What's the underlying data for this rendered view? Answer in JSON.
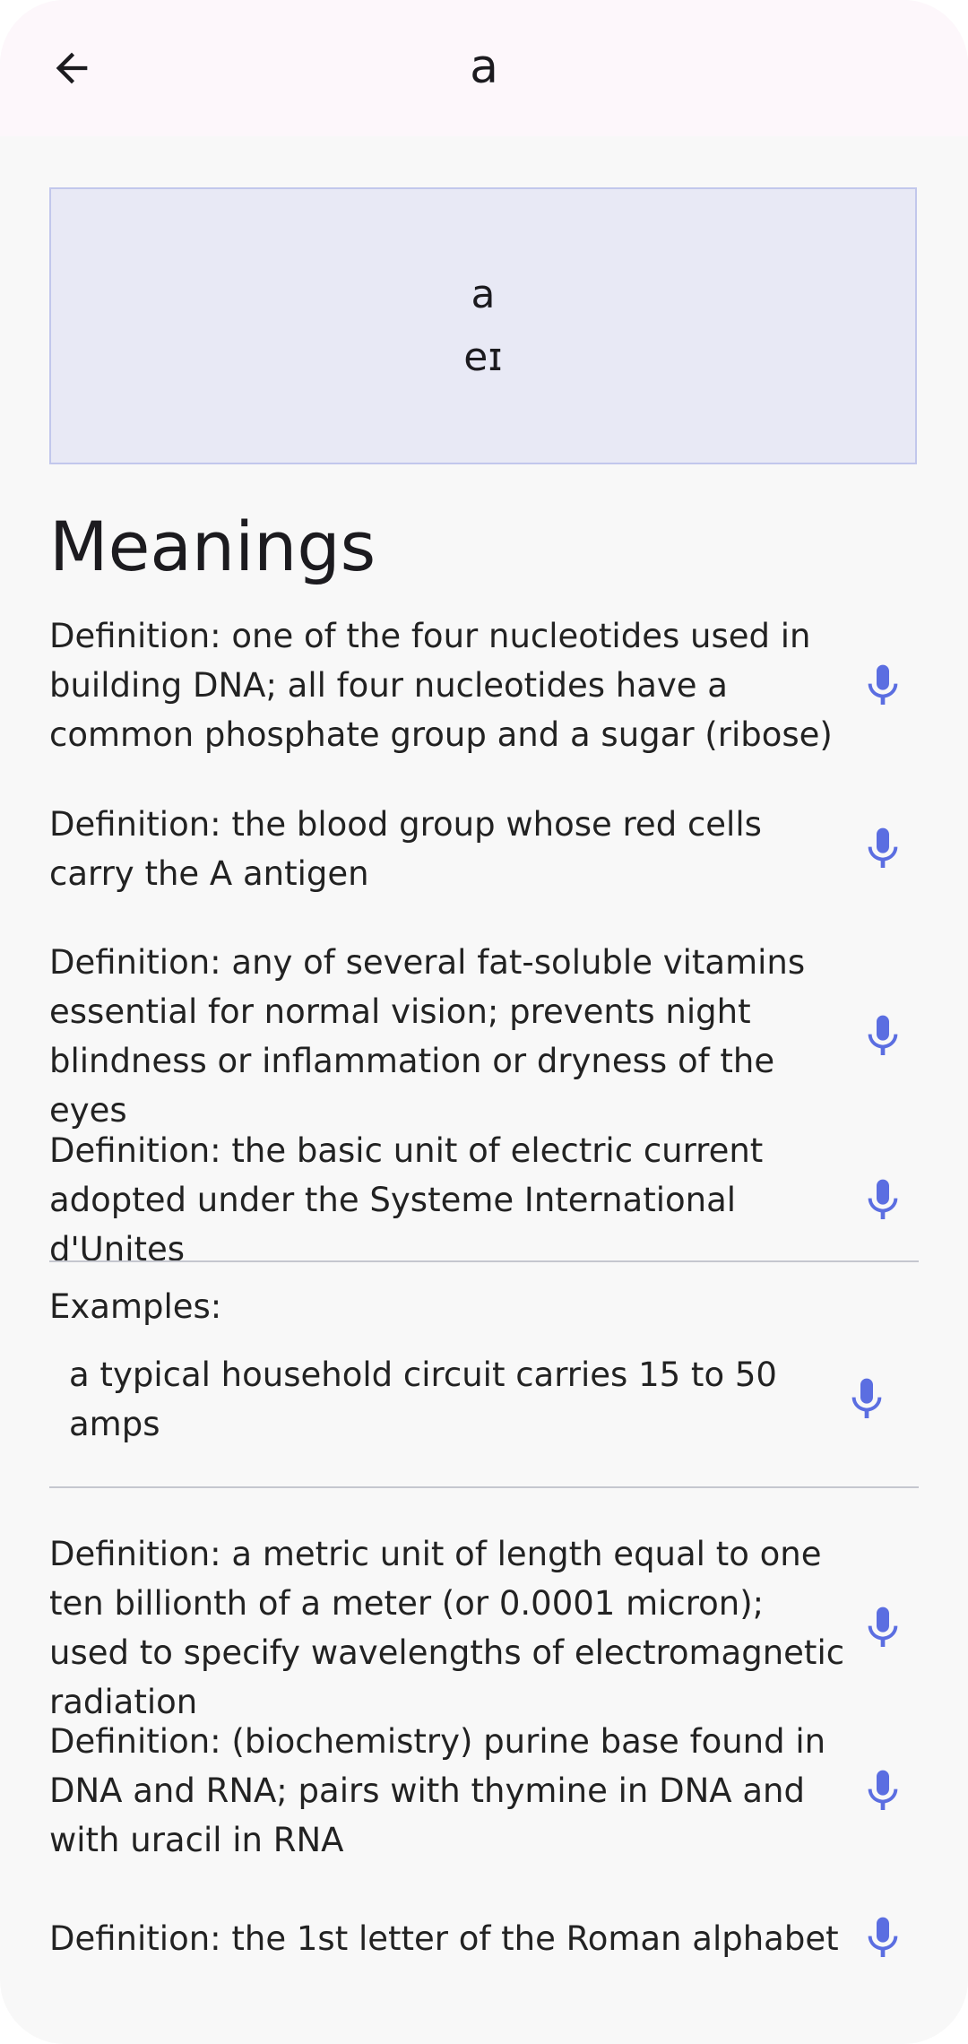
{
  "app_bar": {
    "title": "a",
    "back_icon": "arrow-back-icon"
  },
  "word_card": {
    "word": "a",
    "phonetic": "eɪ"
  },
  "meanings_heading": "Meanings",
  "definitions_group_1": [
    {
      "text": "Definition: one of the four nucleotides used in building DNA; all four nucleotides have a common phosphate group and a sugar (ribose)",
      "icon": "microphone-icon"
    },
    {
      "text": "Definition: the blood group whose red cells carry the A antigen",
      "icon": "microphone-icon"
    },
    {
      "text": "Definition: any of several fat-soluble vitamins essential for normal vision; prevents night blindness or inflammation or dryness of the eyes",
      "icon": "microphone-icon"
    },
    {
      "text": "Definition: the basic unit of electric current adopted under the Systeme International d'Unites",
      "icon": "microphone-icon"
    }
  ],
  "examples": {
    "label": "Examples:",
    "items": [
      {
        "text": "a typical household circuit carries 15 to 50 amps",
        "icon": "microphone-icon"
      }
    ]
  },
  "definitions_group_2": [
    {
      "text": "Definition: a metric unit of length equal to one ten billionth of a meter (or 0.0001 micron); used to specify wavelengths of electromagnetic radiation",
      "icon": "microphone-icon"
    },
    {
      "text": "Definition: (biochemistry) purine base found in DNA and RNA; pairs with thymine in DNA and with uracil in RNA",
      "icon": "microphone-icon"
    },
    {
      "text": "Definition: the 1st letter of the Roman alphabet",
      "icon": "microphone-icon"
    }
  ],
  "colors": {
    "app_bar_bg": "#fdf7fb",
    "page_bg": "#f8f8f8",
    "card_bg": "#e8e9f5",
    "card_border": "#c2c7ec",
    "mic_accent": "#5b6ee1",
    "divider": "#c5c7cf"
  }
}
